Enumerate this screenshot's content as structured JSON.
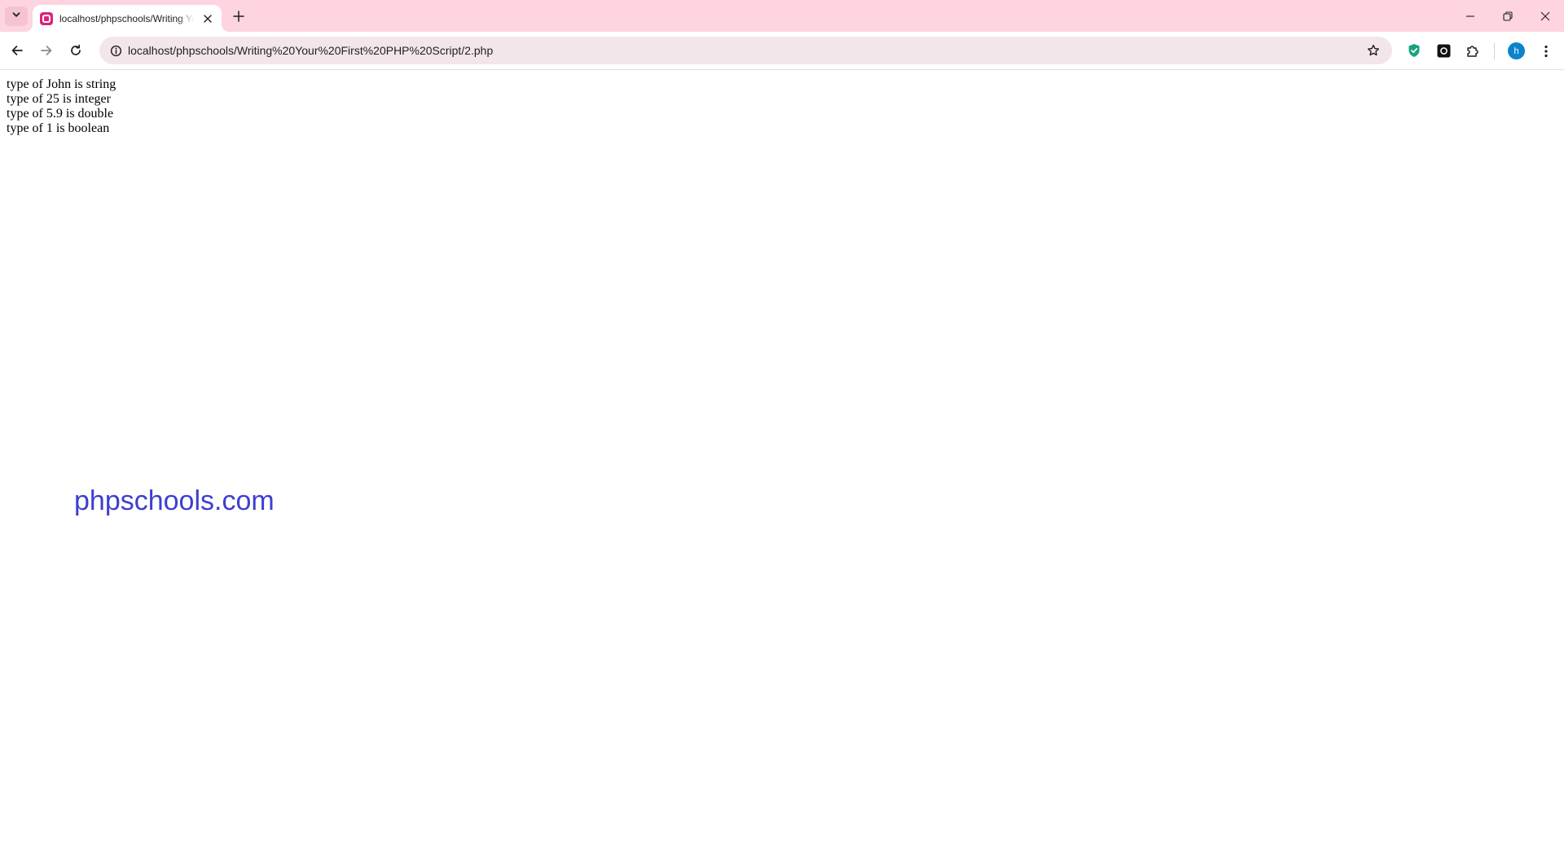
{
  "browser": {
    "tab": {
      "title": "localhost/phpschools/Writing Your First PHP Script/2.php"
    },
    "address_bar": {
      "url": "localhost/phpschools/Writing%20Your%20First%20PHP%20Script/2.php"
    },
    "profile": {
      "initial": "h"
    },
    "icons": {
      "tab_search": "chevron-down-icon",
      "favicon": "php-storm-favicon",
      "tab_close": "close-icon",
      "new_tab": "plus-icon",
      "back": "back-arrow-icon",
      "forward": "forward-arrow-icon",
      "reload": "reload-icon",
      "site_info": "info-icon",
      "bookmark": "star-icon",
      "extension_1": "shield-extension-icon",
      "extension_2": "dark-extension-icon",
      "extensions": "puzzle-icon",
      "menu": "kebab-menu-icon",
      "minimize": "minimize-icon",
      "restore": "restore-icon",
      "close_window": "close-icon"
    },
    "colors": {
      "tabstrip": "#fdd4df",
      "omnibox": "#f3e6ea",
      "favicon": "#e0207b",
      "avatar": "#0b84c9"
    }
  },
  "page": {
    "lines": [
      "type of John is string",
      "type of 25 is integer",
      "type of 5.9 is double",
      "type of 1 is boolean"
    ],
    "watermark": "phpschools.com",
    "watermark_color": "#3d3fcf"
  }
}
